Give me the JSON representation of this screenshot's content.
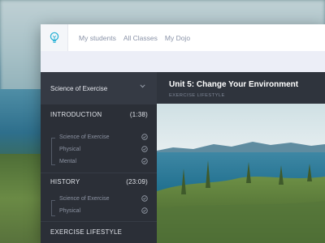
{
  "topnav": {
    "items": [
      "My students",
      "All Classes",
      "My Dojo"
    ]
  },
  "course": {
    "name": "Science of Exercise"
  },
  "sections": [
    {
      "title": "INTRODUCTION",
      "duration": "(1:38)",
      "lessons": [
        "Science of Exercise",
        "Physical",
        "Mental"
      ]
    },
    {
      "title": "HISTORY",
      "duration": "(23:09)",
      "lessons": [
        "Science of Exercise",
        "Physical"
      ]
    },
    {
      "title": "EXERCISE LIFESTYLE",
      "duration": "",
      "lessons": []
    }
  ],
  "unit": {
    "title": "Unit 5: Change Your Environment",
    "category": "EXERCISE LIFESTYLE"
  },
  "colors": {
    "accent": "#2eb3d6",
    "sidebar": "#2b2f37",
    "header": "#353a44"
  }
}
